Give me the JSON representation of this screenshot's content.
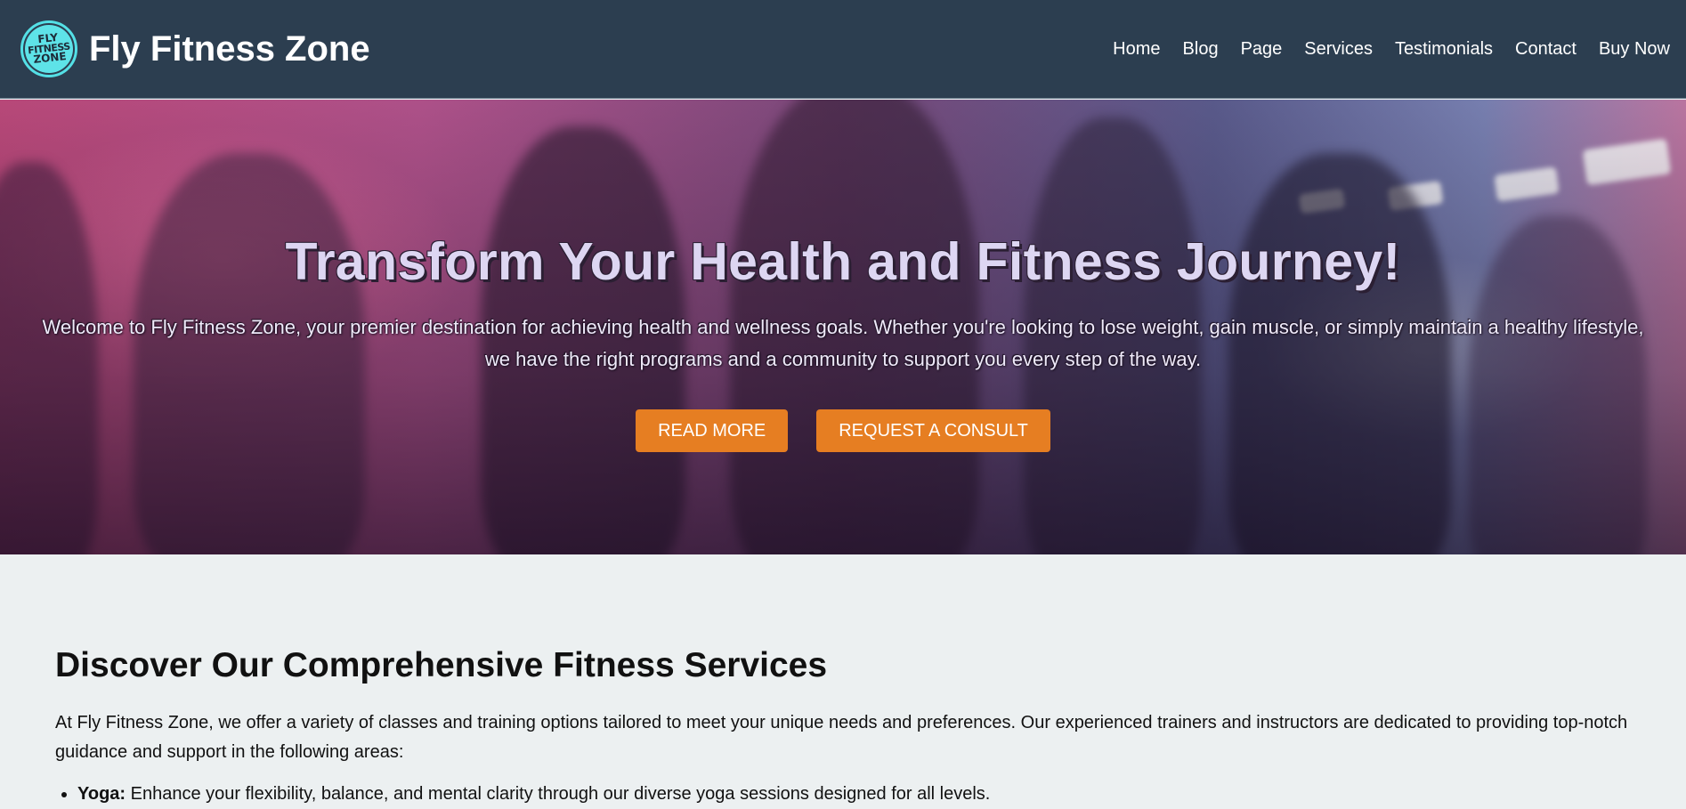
{
  "header": {
    "logo_text": [
      "FLY",
      "FITNESS",
      "ZONE"
    ],
    "brand_name": "Fly Fitness Zone",
    "nav": [
      {
        "label": "Home"
      },
      {
        "label": "Blog"
      },
      {
        "label": "Page"
      },
      {
        "label": "Services"
      },
      {
        "label": "Testimonials"
      },
      {
        "label": "Contact"
      },
      {
        "label": "Buy Now"
      }
    ]
  },
  "hero": {
    "title": "Transform Your Health and Fitness Journey!",
    "text": "Welcome to Fly Fitness Zone, your premier destination for achieving health and wellness goals. Whether you're looking to lose weight, gain muscle, or simply maintain a healthy lifestyle, we have the right programs and a community to support you every step of the way.",
    "read_more_label": "READ MORE",
    "consult_label": "REQUEST A CONSULT"
  },
  "services": {
    "title": "Discover Our Comprehensive Fitness Services",
    "intro": "At Fly Fitness Zone, we offer a variety of classes and training options tailored to meet your unique needs and preferences. Our experienced trainers and instructors are dedicated to providing top-notch guidance and support in the following areas:",
    "items": [
      {
        "name": "Yoga:",
        "description": " Enhance your flexibility, balance, and mental clarity through our diverse yoga sessions designed for all levels."
      }
    ]
  },
  "colors": {
    "header_bg": "#2c3e50",
    "accent": "#e67e22",
    "logo_accent": "#5ee3e8",
    "page_bg": "#ecf0f1"
  }
}
